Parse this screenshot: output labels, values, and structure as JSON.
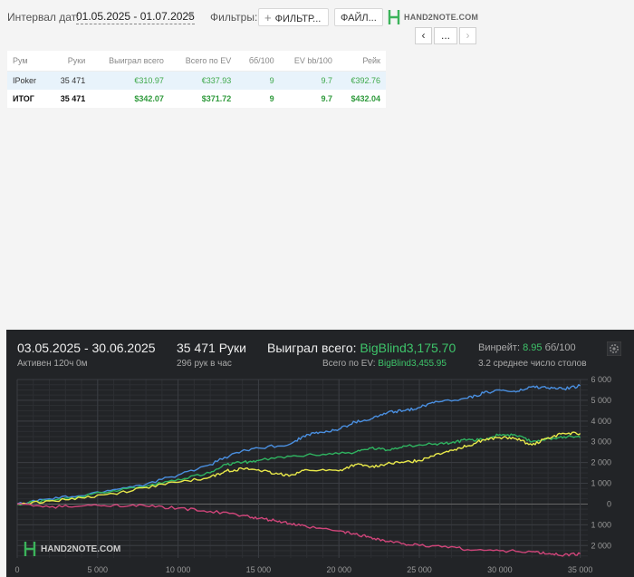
{
  "toolbar": {
    "interval_label": "Интервал дат:",
    "interval_value": "01.05.2025 - 01.07.2025",
    "filters_label": "Фильтры:",
    "filters_button": "ФИЛЬТР...",
    "files_button": "ФАЙЛ...",
    "logo_text": "HAND2NOTE.COM",
    "nav_more": "..."
  },
  "table": {
    "headers": [
      "Рум",
      "Руки",
      "Выиграл всего",
      "Всего по EV",
      "бб/100",
      "EV bb/100",
      "Рейк"
    ],
    "rows": [
      {
        "room": "IPoker",
        "hands": "35 471",
        "won": "€310.97",
        "ev": "€337.93",
        "bb100": "9",
        "evbb": "9.7",
        "rake": "€392.76"
      }
    ],
    "total": {
      "room": "ИТОГ",
      "hands": "35 471",
      "won": "$342.07",
      "ev": "$371.72",
      "bb100": "9",
      "evbb": "9.7",
      "rake": "$432.04"
    }
  },
  "panel": {
    "period": "03.05.2025 - 30.06.2025",
    "active": "Активен 120ч 0м",
    "hands_title": "35 471 Руки",
    "hands_per_hour": "296 рук в час",
    "won_label": "Выиграл всего:",
    "won_value": "BigBlind3,175.70",
    "ev_label": "Всего по EV:",
    "ev_value": "BigBlind3,455.95",
    "winrate_label": "Винрейт:",
    "winrate_value": "8.95",
    "winrate_unit": "бб/100",
    "tables_avg": "3.2 среднее число столов",
    "watermark": "HAND2NOTE.COM"
  },
  "chart_data": {
    "type": "line",
    "x_ticks": [
      "0",
      "5 000",
      "10 000",
      "15 000",
      "20 000",
      "25 000",
      "30 000",
      "35 000"
    ],
    "y_ticks": [
      "6 000",
      "5 000",
      "4 000",
      "3 000",
      "2 000",
      "1 000",
      "0",
      "1 000",
      "2 000"
    ],
    "xlim": [
      0,
      35471
    ],
    "ylim": [
      -2600,
      6000
    ],
    "colors": {
      "blue": "#4a8fe0",
      "green": "#2fb360",
      "yellow": "#e8e84a",
      "red": "#d0457a"
    },
    "series": [
      {
        "color": "blue",
        "points": [
          [
            0,
            0
          ],
          [
            2000,
            250
          ],
          [
            4000,
            400
          ],
          [
            6000,
            700
          ],
          [
            8000,
            950
          ],
          [
            10000,
            1400
          ],
          [
            12000,
            1900
          ],
          [
            13500,
            2450
          ],
          [
            15000,
            2700
          ],
          [
            17000,
            2900
          ],
          [
            18000,
            3350
          ],
          [
            19000,
            3450
          ],
          [
            20000,
            3600
          ],
          [
            21000,
            3950
          ],
          [
            22000,
            4100
          ],
          [
            23000,
            4400
          ],
          [
            24000,
            4500
          ],
          [
            25000,
            4650
          ],
          [
            26000,
            4950
          ],
          [
            28000,
            5100
          ],
          [
            29000,
            5350
          ],
          [
            30000,
            5500
          ],
          [
            31000,
            5400
          ],
          [
            32000,
            5650
          ],
          [
            33000,
            5600
          ],
          [
            34000,
            5550
          ],
          [
            35000,
            5700
          ]
        ]
      },
      {
        "color": "green",
        "points": [
          [
            0,
            0
          ],
          [
            2000,
            200
          ],
          [
            4000,
            350
          ],
          [
            6000,
            650
          ],
          [
            8000,
            850
          ],
          [
            10000,
            1200
          ],
          [
            12000,
            1500
          ],
          [
            13000,
            1900
          ],
          [
            14000,
            2000
          ],
          [
            15000,
            2100
          ],
          [
            17000,
            2300
          ],
          [
            19000,
            2400
          ],
          [
            21000,
            2500
          ],
          [
            22000,
            2700
          ],
          [
            23000,
            2600
          ],
          [
            24000,
            2800
          ],
          [
            26000,
            2900
          ],
          [
            27000,
            2950
          ],
          [
            28000,
            3100
          ],
          [
            29000,
            3100
          ],
          [
            30000,
            3350
          ],
          [
            31000,
            3300
          ],
          [
            32000,
            3000
          ],
          [
            33000,
            3150
          ],
          [
            34000,
            3250
          ],
          [
            35000,
            3200
          ]
        ]
      },
      {
        "color": "yellow",
        "points": [
          [
            0,
            0
          ],
          [
            2000,
            150
          ],
          [
            4000,
            300
          ],
          [
            6000,
            500
          ],
          [
            8000,
            800
          ],
          [
            10000,
            1050
          ],
          [
            12000,
            1300
          ],
          [
            13000,
            1600
          ],
          [
            14000,
            1700
          ],
          [
            15000,
            1650
          ],
          [
            16000,
            1450
          ],
          [
            17000,
            1400
          ],
          [
            18000,
            1650
          ],
          [
            20000,
            1600
          ],
          [
            21000,
            1900
          ],
          [
            22000,
            1800
          ],
          [
            23000,
            1950
          ],
          [
            24000,
            2000
          ],
          [
            25000,
            2100
          ],
          [
            26000,
            2400
          ],
          [
            27000,
            2600
          ],
          [
            28000,
            2800
          ],
          [
            29000,
            3100
          ],
          [
            30000,
            3200
          ],
          [
            31000,
            3150
          ],
          [
            32000,
            2850
          ],
          [
            33000,
            3200
          ],
          [
            34000,
            3400
          ],
          [
            35000,
            3400
          ]
        ]
      },
      {
        "color": "red",
        "points": [
          [
            0,
            0
          ],
          [
            2000,
            -150
          ],
          [
            4000,
            -100
          ],
          [
            6000,
            -50
          ],
          [
            8000,
            -100
          ],
          [
            10000,
            -200
          ],
          [
            12000,
            -350
          ],
          [
            14000,
            -550
          ],
          [
            15000,
            -700
          ],
          [
            16000,
            -800
          ],
          [
            17000,
            -950
          ],
          [
            18000,
            -1100
          ],
          [
            20000,
            -1300
          ],
          [
            21000,
            -1450
          ],
          [
            22000,
            -1600
          ],
          [
            23000,
            -1800
          ],
          [
            24000,
            -1900
          ],
          [
            25000,
            -2000
          ],
          [
            27000,
            -2050
          ],
          [
            28000,
            -2200
          ],
          [
            30000,
            -2250
          ],
          [
            32000,
            -2300
          ],
          [
            33000,
            -2400
          ],
          [
            34000,
            -2450
          ],
          [
            35000,
            -2400
          ]
        ]
      }
    ]
  }
}
